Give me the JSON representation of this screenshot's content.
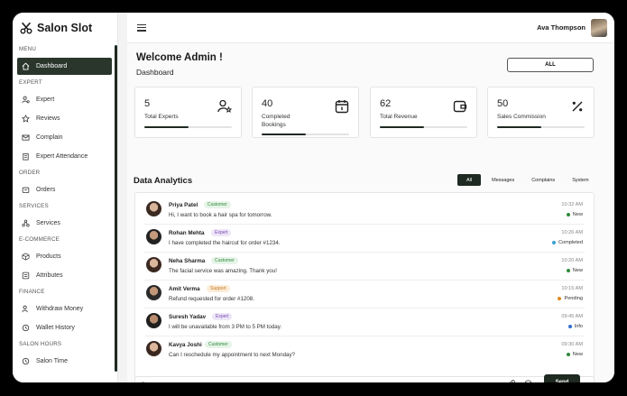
{
  "brand": {
    "name": "Salon Slot"
  },
  "sidebar": {
    "sections": {
      "menu": "MENU",
      "expert": "EXPERT",
      "order": "ORDER",
      "services": "SERVICES",
      "ecommerce": "E-COMMERCE",
      "finance": "FINANCE",
      "salon_hours": "SALON HOURS"
    },
    "items": {
      "dashboard": "Dashboard",
      "expert": "Expert",
      "reviews": "Reviews",
      "complain": "Complain",
      "expert_attendance": "Expert Attendance",
      "orders": "Orders",
      "services": "Services",
      "products": "Products",
      "attributes": "Attributes",
      "withdraw_money": "Withdraw Money",
      "wallet_history": "Wallet History",
      "salon_time": "Salon Time"
    }
  },
  "header": {
    "user_name": "Ava Thompson"
  },
  "page": {
    "welcome": "Welcome Admin !",
    "breadcrumb": "Dashboard",
    "filter_button": "ALL"
  },
  "stats": [
    {
      "value": "5",
      "label": "Total Experts",
      "progress": 0.5,
      "icon": "user-star-icon"
    },
    {
      "value": "40",
      "label": "Completed Bookings",
      "progress": 0.5,
      "icon": "calendar-icon"
    },
    {
      "value": "62",
      "label": "Total Revenue",
      "progress": 0.5,
      "icon": "wallet-icon"
    },
    {
      "value": "50",
      "label": "Sales Commission",
      "progress": 0.5,
      "icon": "percent-icon"
    }
  ],
  "analytics": {
    "title": "Data Analytics",
    "filters": [
      "All",
      "Messages",
      "Complains",
      "System"
    ],
    "active_filter": "All",
    "messages": [
      {
        "name": "Priya Patel",
        "role": "Customer",
        "text": "Hi, I want to book a hair spa for tomorrow.",
        "time": "10:32 AM",
        "status": "New",
        "status_color": "#2f8a3a"
      },
      {
        "name": "Rohan Mehta",
        "role": "Expert",
        "text": "I have completed the haircut for order #1234.",
        "time": "10:26 AM",
        "status": "Completed",
        "status_color": "#3aa0d8"
      },
      {
        "name": "Neha Sharma",
        "role": "Customer",
        "text": "The facial service was amazing. Thank you!",
        "time": "10:20 AM",
        "status": "New",
        "status_color": "#2f8a3a"
      },
      {
        "name": "Amit Verma",
        "role": "Support",
        "text": "Refund requested for order #1208.",
        "time": "10:15 AM",
        "status": "Pending",
        "status_color": "#e08a1e"
      },
      {
        "name": "Suresh Yadav",
        "role": "Expert",
        "text": "I will be unavailable from 3 PM to 5 PM today.",
        "time": "09:45 AM",
        "status": "Info",
        "status_color": "#2f6fd1"
      },
      {
        "name": "Kavya Joshi",
        "role": "Customer",
        "text": "Can I reschedule my appointment to next Monday?",
        "time": "09:30 AM",
        "status": "New",
        "status_color": "#2f8a3a"
      }
    ]
  },
  "composer": {
    "placeholder": "Type a message...",
    "send_label": "Send"
  },
  "colors": {
    "accent": "#1f2a22",
    "background": "#fafafa"
  }
}
